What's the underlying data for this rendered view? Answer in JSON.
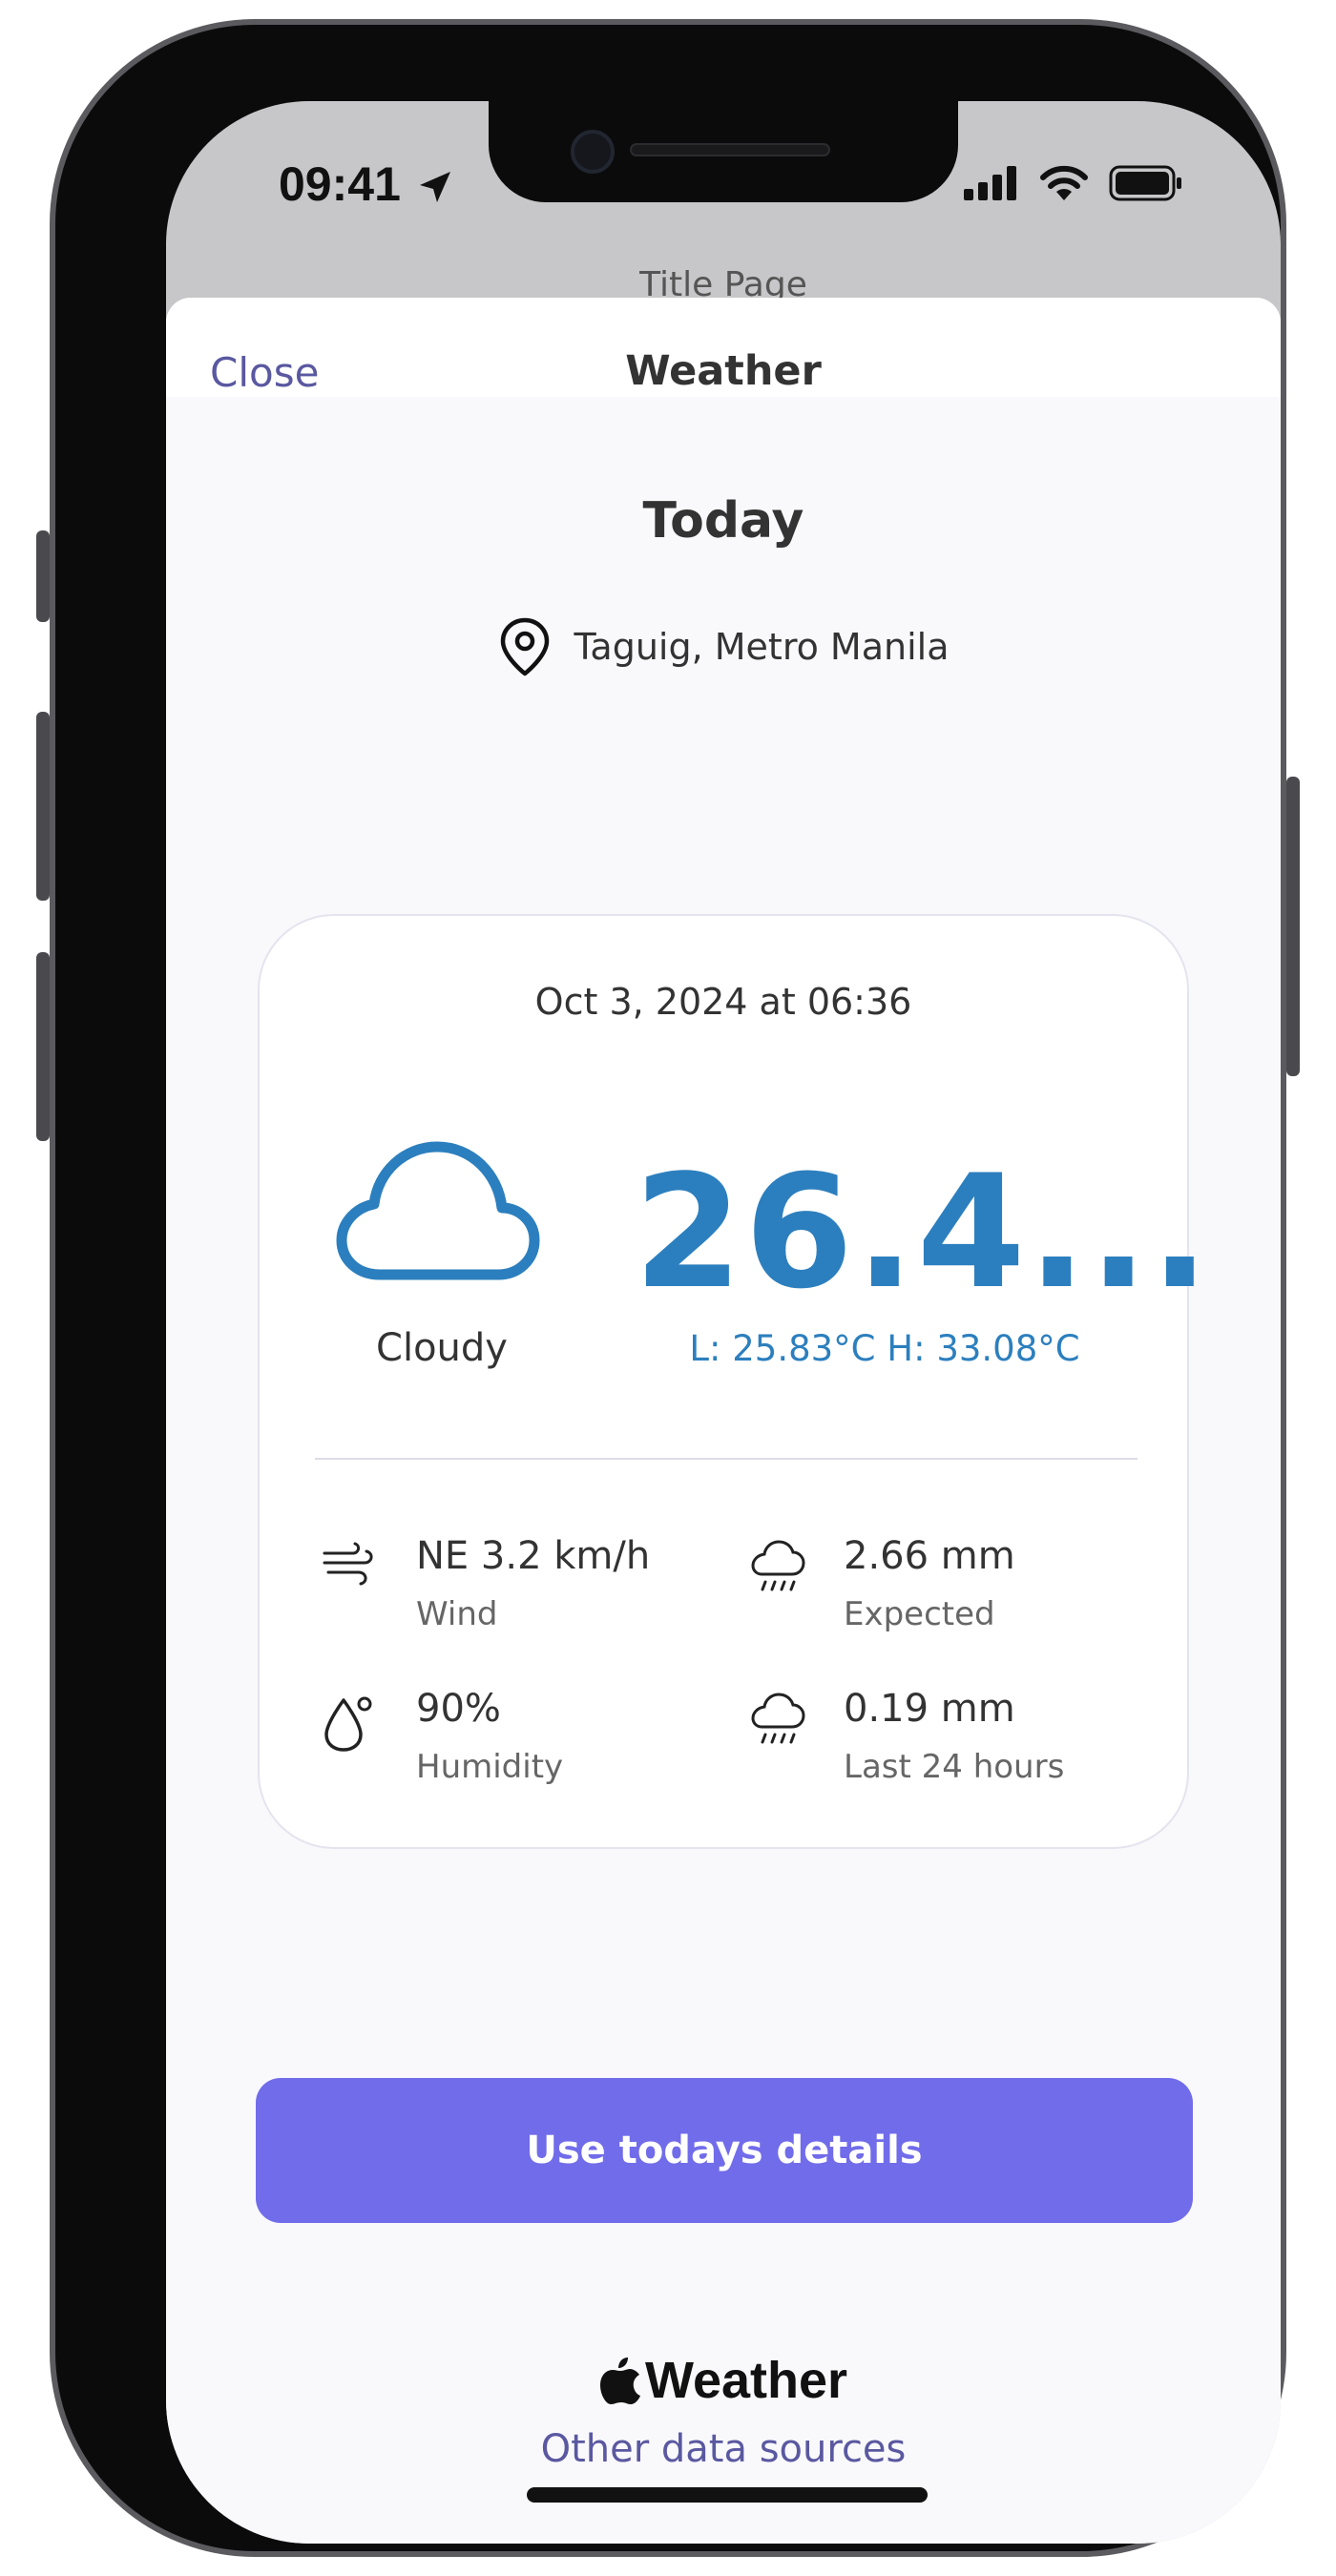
{
  "status_bar": {
    "time": "09:41"
  },
  "background_screen": {
    "title": "Title Page"
  },
  "sheet": {
    "close_label": "Close",
    "title": "Weather"
  },
  "today": {
    "heading": "Today",
    "location": "Taguig, Metro Manila"
  },
  "card": {
    "date": "Oct 3, 2024 at 06:36",
    "condition": "Cloudy",
    "temperature": "26.4...",
    "low_high": "L: 25.83°C H: 33.08°C",
    "stats": {
      "wind_value": "NE 3.2 km/h",
      "wind_label": "Wind",
      "expected_value": "2.66 mm",
      "expected_label": "Expected",
      "humidity_value": "90%",
      "humidity_label": "Humidity",
      "last24_value": "0.19 mm",
      "last24_label": "Last 24 hours"
    }
  },
  "actions": {
    "use_details_label": "Use todays details"
  },
  "attribution": {
    "brand": "Weather",
    "other_sources_label": "Other data sources"
  },
  "colors": {
    "accent": "#716cea",
    "link": "#5a58a0",
    "temperature": "#2c7fbe"
  },
  "icons": [
    "location-arrow-icon",
    "cellular-signal-icon",
    "wifi-icon",
    "battery-icon",
    "map-pin-icon",
    "cloud-icon",
    "wind-icon",
    "rain-cloud-icon",
    "droplet-icon",
    "apple-logo-icon"
  ]
}
